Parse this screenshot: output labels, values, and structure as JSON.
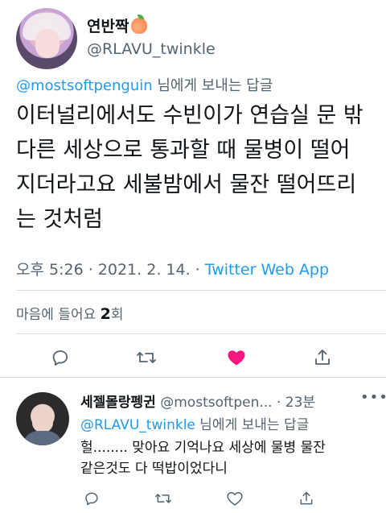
{
  "tweet": {
    "display_name": "연반짝",
    "handle": "@RLAVU_twinkle",
    "reply_to_mention": "@mostsoftpenguin",
    "reply_to_suffix": " 님에게 보내는 답글",
    "body_lines": [
      "이터널리에서도 수빈이가 연습실 문 밖",
      "다른 세상으로 통과할 때 물병이 떨어",
      "지더라고요 세불밤에서 물잔 떨어뜨리",
      "는 것처럼"
    ],
    "time": "오후 5:26",
    "separator": " · ",
    "date": "2021. 2. 14.",
    "source": "Twitter Web App",
    "likes_label": "마음에 들어요 ",
    "likes_count": "2",
    "likes_unit": "회",
    "liked": true
  },
  "reply": {
    "display_name": "세젤몰랑펭귄",
    "handle": " @mostsoftpen...",
    "separator": " · ",
    "time": "23분",
    "reply_to_mention": "@RLAVU_twinkle",
    "reply_to_suffix": " 님에게 보내는 답글",
    "body_lines": [
      "헐........ 맞아요 기억나요 세상에 물병 물잔",
      "같은것도 다 떡밥이었다니"
    ]
  },
  "icons": {
    "reply": "reply-icon",
    "retweet": "retweet-icon",
    "like": "heart-icon",
    "share": "share-icon",
    "more": "more-icon"
  },
  "colors": {
    "accent": "#1d9bf0",
    "like": "#f91880",
    "muted": "#536471",
    "text": "#0f1419"
  }
}
